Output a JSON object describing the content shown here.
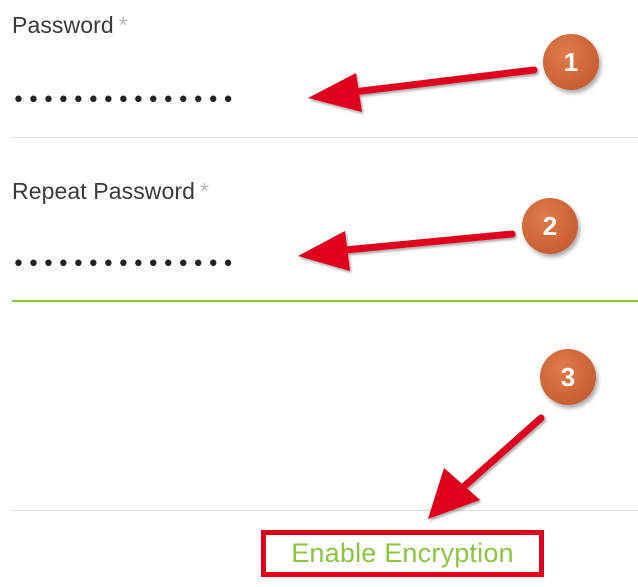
{
  "form": {
    "password": {
      "label": "Password",
      "required_mark": "*",
      "value": "•••••••••••••••"
    },
    "repeat_password": {
      "label": "Repeat Password",
      "required_mark": "*",
      "value": "•••••••••••••••"
    },
    "enable_encryption_label": "Enable Encryption"
  },
  "annotations": {
    "steps": [
      "1",
      "2",
      "3"
    ],
    "arrow_color": "#e0001b",
    "marker_color": "#c9623a"
  },
  "colors": {
    "accent_green": "#8cc63f",
    "highlight_red": "#e0001b"
  }
}
